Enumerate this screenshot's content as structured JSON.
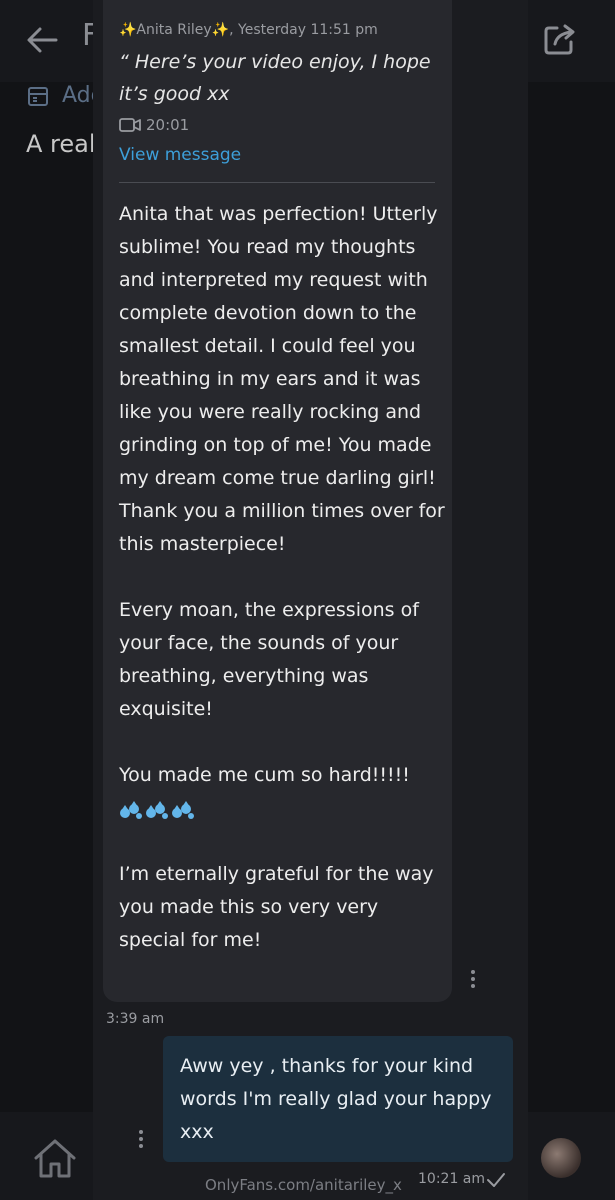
{
  "background": {
    "title_partial": "F",
    "add_partial": "Adc",
    "subtitle_partial": "A real"
  },
  "message_in": {
    "reply_header": "✨Anita Riley✨, Yesterday 11:51 pm",
    "reply_quote": "“ Here’s your video enjoy, I hope it’s good xx",
    "video_duration": "20:01",
    "view_message_label": "View message",
    "paragraph_1": "Anita that was perfection! Utterly sublime! You read my thoughts and interpreted my request with complete devotion down to the smallest detail. I could feel you breathing in my ears and it was like you were really rocking and grinding on top of me! You made my dream come true darling girl! Thank you a million times over for this masterpiece!",
    "paragraph_2": "Every moan, the expressions of your face, the sounds of your breathing, everything was exquisite!",
    "paragraph_3": "You made me cum so hard!!!!!",
    "emoji": "💦💦💦",
    "paragraph_4": "I’m eternally grateful for the way you made this so very very special for me!",
    "time": "3:39 am"
  },
  "message_out": {
    "text": "Aww yey , thanks for your kind words I'm really glad your happy xxx",
    "time": "10:21 am"
  },
  "watermark": "OnlyFans.com/anitariley_x",
  "colors": {
    "link": "#3d9fd9",
    "bubble_in": "#27282d",
    "bubble_out": "#1c2f3e",
    "drops": "#63b6ea"
  }
}
